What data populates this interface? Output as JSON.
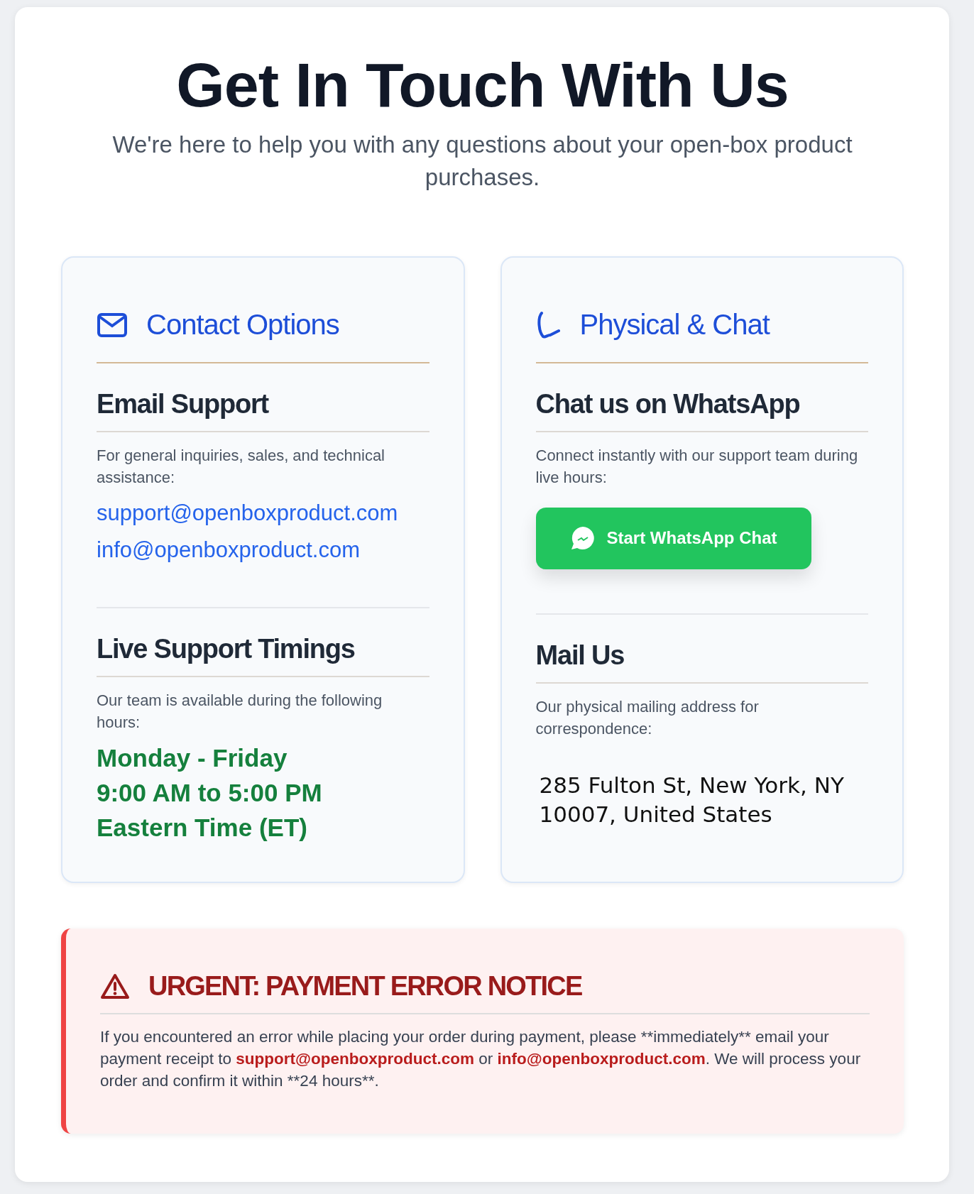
{
  "header": {
    "title": "Get In Touch With Us",
    "subtitle": "We're here to help you with any questions about your open-box product purchases."
  },
  "cards": [
    {
      "title": "Contact Options",
      "sections": [
        {
          "kind": "emails",
          "heading": "Email Support",
          "description": "For general inquiries, sales, and technical assistance:",
          "links": [
            "support@openboxproduct.com",
            "info@openboxproduct.com"
          ]
        },
        {
          "kind": "hours",
          "heading": "Live Support Timings",
          "description": "Our team is available during the following hours:",
          "lines": [
            "Monday - Friday",
            "9:00 AM to 5:00 PM",
            "Eastern Time (ET)"
          ]
        }
      ]
    },
    {
      "title": "Physical & Chat",
      "sections": [
        {
          "kind": "chat",
          "heading": "Chat us on WhatsApp",
          "description": "Connect instantly with our support team during live hours:",
          "button": "Start WhatsApp Chat"
        },
        {
          "kind": "address",
          "heading": "Mail Us",
          "description": "Our physical mailing address for correspondence:",
          "address": "285 Fulton St, New York, NY 10007, United States"
        }
      ]
    }
  ],
  "notice": {
    "title": "URGENT: PAYMENT ERROR NOTICE",
    "body": [
      {
        "kind": "text",
        "text": "If you encountered an error while placing your order during payment, please **immediately** email your payment receipt to "
      },
      {
        "kind": "link",
        "text": "support@openboxproduct.com"
      },
      {
        "kind": "text",
        "text": " or "
      },
      {
        "kind": "link",
        "text": "info@openboxproduct.com"
      },
      {
        "kind": "text",
        "text": ". We will process your order and confirm it within **24 hours**."
      }
    ]
  }
}
